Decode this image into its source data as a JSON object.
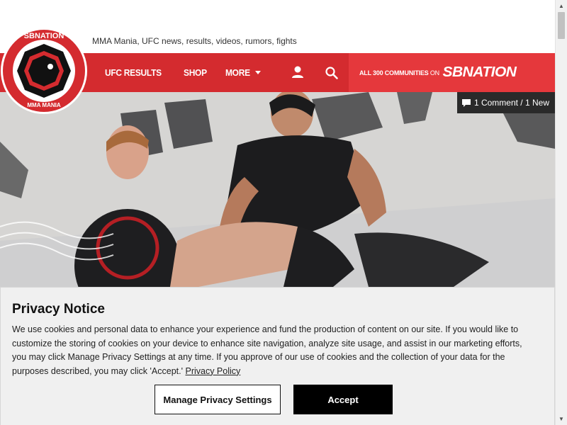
{
  "site": {
    "tagline": "MMA Mania, UFC news, results, videos, rumors, fights",
    "logo_top_text": "SBNATION",
    "logo_bottom_text": "MMA MANIA"
  },
  "nav": {
    "links": [
      {
        "label": "UFC RESULTS"
      },
      {
        "label": "SHOP"
      },
      {
        "label": "MORE"
      }
    ],
    "user_icon": "user-icon",
    "search_icon": "search-icon",
    "communities_prefix": "ALL 300 COMMUNITIES",
    "communities_on": "ON",
    "network_name": "SBNATION"
  },
  "hero": {
    "comment_badge": "1 Comment / 1 New"
  },
  "privacy": {
    "title": "Privacy Notice",
    "body": "We use cookies and personal data to enhance your experience and fund the production of content on our site. If you would like to customize the storing of cookies on your device to enhance site navigation, analyze site usage, and assist in our marketing efforts, you may click Manage Privacy Settings at any time. If you approve of our use of cookies and the collection of your data for the purposes described, you may click 'Accept.'",
    "link": "Privacy Policy",
    "manage_button": "Manage Privacy Settings",
    "accept_button": "Accept"
  },
  "colors": {
    "brand_red": "#d42b2f",
    "sbn_red": "#e5383c"
  }
}
